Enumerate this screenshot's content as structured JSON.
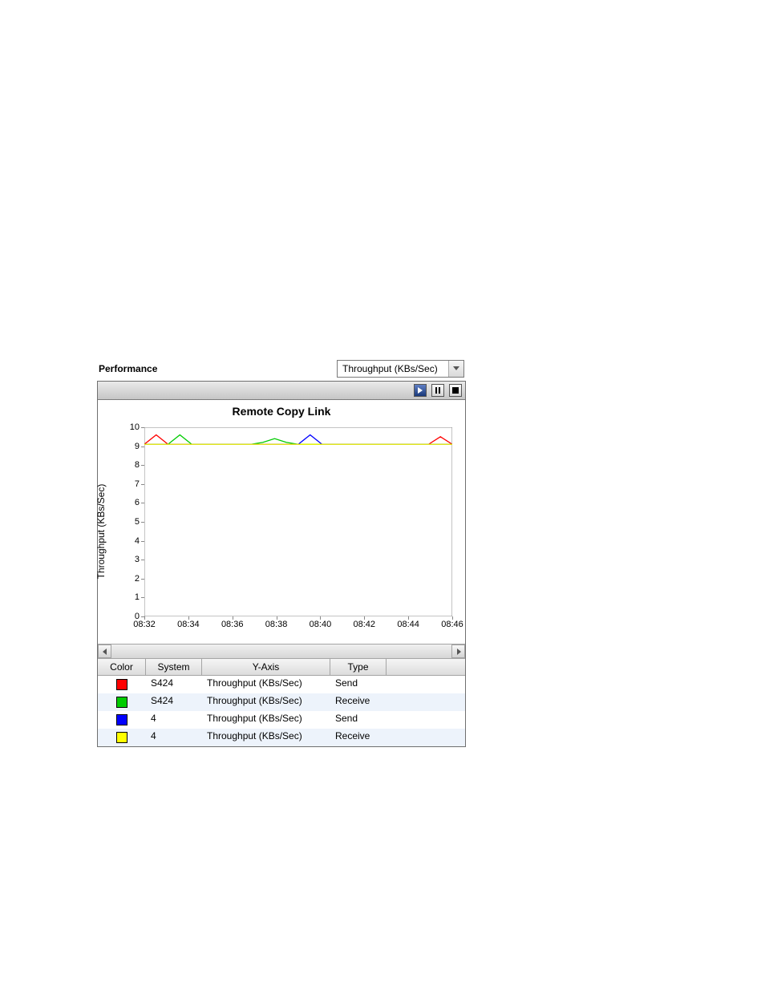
{
  "title": "Performance",
  "metric_select": {
    "value": "Throughput (KBs/Sec)"
  },
  "chart_title": "Remote Copy Link",
  "ylabel": "Throughput (KBs/Sec)",
  "columns": {
    "color": "Color",
    "system": "System",
    "yaxis": "Y-Axis",
    "type": "Type"
  },
  "series": [
    {
      "system": "S424",
      "yaxis": "Throughput (KBs/Sec)",
      "type": "Send",
      "color": "#ff0000"
    },
    {
      "system": "S424",
      "yaxis": "Throughput (KBs/Sec)",
      "type": "Receive",
      "color": "#00cc00"
    },
    {
      "system": "4",
      "yaxis": "Throughput (KBs/Sec)",
      "type": "Send",
      "color": "#0000ff"
    },
    {
      "system": "4",
      "yaxis": "Throughput (KBs/Sec)",
      "type": "Receive",
      "color": "#ffff00"
    }
  ],
  "chart_data": {
    "type": "line",
    "title": "Remote Copy Link",
    "xlabel": "",
    "ylabel": "Throughput (KBs/Sec)",
    "xlim": [
      "08:32",
      "08:46"
    ],
    "ylim": [
      0,
      10
    ],
    "x_ticks": [
      "08:32",
      "08:34",
      "08:36",
      "08:38",
      "08:40",
      "08:42",
      "08:44",
      "08:46"
    ],
    "y_ticks": [
      0,
      1,
      2,
      3,
      4,
      5,
      6,
      7,
      8,
      9,
      10
    ],
    "x": [
      "08:32",
      "08:32.5",
      "08:33",
      "08:33.5",
      "08:34",
      "08:34.5",
      "08:35",
      "08:35.5",
      "08:36",
      "08:36.5",
      "08:37",
      "08:37.5",
      "08:38",
      "08:38.5",
      "08:39",
      "08:39.5",
      "08:40",
      "08:40.5",
      "08:41",
      "08:41.5",
      "08:42",
      "08:42.5",
      "08:43",
      "08:43.5",
      "08:44",
      "08:44.5",
      "08:45"
    ],
    "series": [
      {
        "name": "S424 Send",
        "color": "#ff0000",
        "values": [
          9.1,
          9.6,
          9.1,
          9.1,
          9.1,
          9.1,
          9.1,
          9.1,
          9.1,
          9.1,
          9.1,
          9.1,
          9.1,
          9.1,
          9.1,
          9.1,
          9.1,
          9.1,
          9.1,
          9.1,
          9.1,
          9.1,
          9.1,
          9.1,
          9.1,
          9.5,
          9.1
        ]
      },
      {
        "name": "S424 Receive",
        "color": "#00cc00",
        "values": [
          9.1,
          9.1,
          9.1,
          9.6,
          9.1,
          9.1,
          9.1,
          9.1,
          9.1,
          9.1,
          9.2,
          9.4,
          9.2,
          9.1,
          9.1,
          9.1,
          9.1,
          9.1,
          9.1,
          9.1,
          9.1,
          9.1,
          9.1,
          9.1,
          9.1,
          9.1,
          9.1
        ]
      },
      {
        "name": "4 Send",
        "color": "#0000ff",
        "values": [
          9.1,
          9.1,
          9.1,
          9.1,
          9.1,
          9.1,
          9.1,
          9.1,
          9.1,
          9.1,
          9.1,
          9.1,
          9.1,
          9.1,
          9.6,
          9.1,
          9.1,
          9.1,
          9.1,
          9.1,
          9.1,
          9.1,
          9.1,
          9.1,
          9.1,
          9.1,
          9.1
        ]
      },
      {
        "name": "4 Receive",
        "color": "#ffff00",
        "values": [
          9.1,
          9.1,
          9.1,
          9.1,
          9.1,
          9.1,
          9.1,
          9.1,
          9.1,
          9.1,
          9.1,
          9.1,
          9.1,
          9.1,
          9.1,
          9.1,
          9.1,
          9.1,
          9.1,
          9.1,
          9.1,
          9.1,
          9.1,
          9.1,
          9.1,
          9.1,
          9.1
        ]
      }
    ]
  }
}
